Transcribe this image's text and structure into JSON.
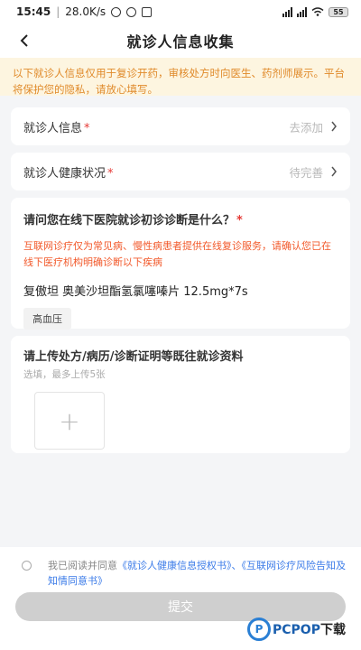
{
  "status": {
    "time": "15:45",
    "speed": "28.0K/s",
    "battery": "55"
  },
  "header": {
    "title": "就诊人信息收集",
    "back_icon": "chevron-left-icon"
  },
  "notice": "以下就诊人信息仅用于复诊开药，审核处方时向医生、药剂师展示。平台将保护您的隐私，请放心填写。",
  "patient_info": {
    "label": "就诊人信息",
    "required": "*",
    "value": "去添加"
  },
  "health": {
    "label": "就诊人健康状况",
    "required": "*",
    "value": "待完善"
  },
  "diagnosis": {
    "title": "请问您在线下医院就诊初诊诊断是什么？",
    "required": "*",
    "warning": "互联网诊疗仅为常见病、慢性病患者提供在线复诊服务，请确认您已在线下医疗机构明确诊断以下疾病",
    "drug": "复傲坦 奥美沙坦酯氢氯噻嗪片 12.5mg*7s",
    "tag": "高血压"
  },
  "upload": {
    "title": "请上传处方/病历/诊断证明等既往就诊资料",
    "hint": "选填，最多上传5张",
    "plus": "+"
  },
  "agreement": {
    "prefix": "我已阅读并同意",
    "link1": "《就诊人健康信息授权书》",
    "sep": "、",
    "link2": "《互联网诊疗风险告知及知情同意书》"
  },
  "submit_label": "提交",
  "watermark": {
    "mark": "P",
    "text1": "PCPOP",
    "text2": "下载"
  },
  "colors": {
    "accent_link": "#3b7be8",
    "warning": "#f25a2c",
    "notice_bg": "#fdf5e0",
    "notice_text": "#e08a2a",
    "required": "#e53935"
  }
}
